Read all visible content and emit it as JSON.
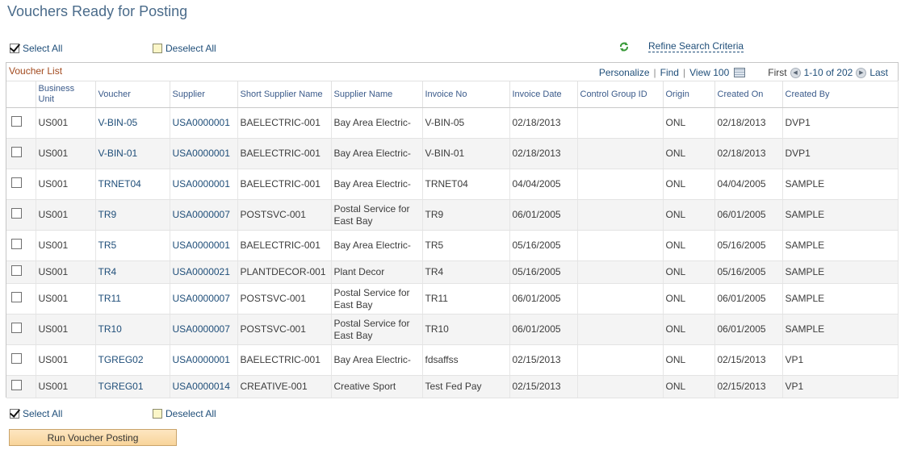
{
  "page": {
    "title": "Vouchers Ready for Posting"
  },
  "selection": {
    "select_all": "Select All",
    "deselect_all": "Deselect All"
  },
  "refine": {
    "label": "Refine Search Criteria",
    "icon": "refresh-icon"
  },
  "grid": {
    "caption": "Voucher List",
    "nav": {
      "personalize": "Personalize",
      "find": "Find",
      "view": "View 100",
      "first": "First",
      "range": "1-10 of 202",
      "last": "Last"
    },
    "columns": [
      "Business Unit",
      "Voucher",
      "Supplier",
      "Short Supplier Name",
      "Supplier Name",
      "Invoice No",
      "Invoice Date",
      "Control Group ID",
      "Origin",
      "Created On",
      "Created By"
    ],
    "rows": [
      {
        "bu": "US001",
        "voucher": "V-BIN-05",
        "supplier": "USA0000001",
        "short": "BAELECTRIC-001",
        "name": "Bay Area Electric-",
        "invoice": "V-BIN-05",
        "inv_date": "02/18/2013",
        "control": "",
        "origin": "ONL",
        "created_on": "02/18/2013",
        "created_by": "DVP1"
      },
      {
        "bu": "US001",
        "voucher": "V-BIN-01",
        "supplier": "USA0000001",
        "short": "BAELECTRIC-001",
        "name": "Bay Area Electric-",
        "invoice": "V-BIN-01",
        "inv_date": "02/18/2013",
        "control": "",
        "origin": "ONL",
        "created_on": "02/18/2013",
        "created_by": "DVP1"
      },
      {
        "bu": "US001",
        "voucher": "TRNET04",
        "supplier": "USA0000001",
        "short": "BAELECTRIC-001",
        "name": "Bay Area Electric-",
        "invoice": "TRNET04",
        "inv_date": "04/04/2005",
        "control": "",
        "origin": "ONL",
        "created_on": "04/04/2005",
        "created_by": "SAMPLE"
      },
      {
        "bu": "US001",
        "voucher": "TR9",
        "supplier": "USA0000007",
        "short": "POSTSVC-001",
        "name": "Postal Service for East Bay",
        "invoice": "TR9",
        "inv_date": "06/01/2005",
        "control": "",
        "origin": "ONL",
        "created_on": "06/01/2005",
        "created_by": "SAMPLE"
      },
      {
        "bu": "US001",
        "voucher": "TR5",
        "supplier": "USA0000001",
        "short": "BAELECTRIC-001",
        "name": "Bay Area Electric-",
        "invoice": "TR5",
        "inv_date": "05/16/2005",
        "control": "",
        "origin": "ONL",
        "created_on": "05/16/2005",
        "created_by": "SAMPLE"
      },
      {
        "bu": "US001",
        "voucher": "TR4",
        "supplier": "USA0000021",
        "short": "PLANTDECOR-001",
        "name": "Plant Decor",
        "invoice": "TR4",
        "inv_date": "05/16/2005",
        "control": "",
        "origin": "ONL",
        "created_on": "05/16/2005",
        "created_by": "SAMPLE"
      },
      {
        "bu": "US001",
        "voucher": "TR11",
        "supplier": "USA0000007",
        "short": "POSTSVC-001",
        "name": "Postal Service for East Bay",
        "invoice": "TR11",
        "inv_date": "06/01/2005",
        "control": "",
        "origin": "ONL",
        "created_on": "06/01/2005",
        "created_by": "SAMPLE"
      },
      {
        "bu": "US001",
        "voucher": "TR10",
        "supplier": "USA0000007",
        "short": "POSTSVC-001",
        "name": "Postal Service for East Bay",
        "invoice": "TR10",
        "inv_date": "06/01/2005",
        "control": "",
        "origin": "ONL",
        "created_on": "06/01/2005",
        "created_by": "SAMPLE"
      },
      {
        "bu": "US001",
        "voucher": "TGREG02",
        "supplier": "USA0000001",
        "short": "BAELECTRIC-001",
        "name": "Bay Area Electric-",
        "invoice": "fdsaffss",
        "inv_date": "02/15/2013",
        "control": "",
        "origin": "ONL",
        "created_on": "02/15/2013",
        "created_by": "VP1"
      },
      {
        "bu": "US001",
        "voucher": "TGREG01",
        "supplier": "USA0000014",
        "short": "CREATIVE-001",
        "name": "Creative Sport",
        "invoice": "Test Fed Pay",
        "inv_date": "02/15/2013",
        "control": "",
        "origin": "ONL",
        "created_on": "02/15/2013",
        "created_by": "VP1"
      }
    ]
  },
  "actions": {
    "run": "Run Voucher Posting"
  }
}
